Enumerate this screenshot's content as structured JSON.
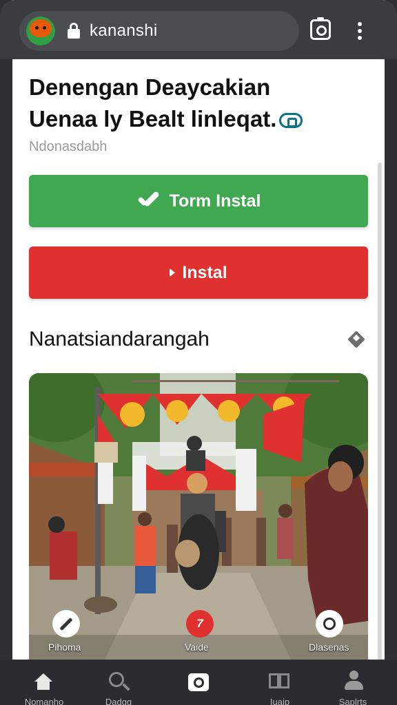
{
  "browser": {
    "url": "kananshi",
    "site_icon": "fox-face-icon",
    "secure_icon": "lock-icon",
    "actions": [
      "camera-icon",
      "more-vert-icon"
    ]
  },
  "article": {
    "headline_line1": "Denengan Deaycakian",
    "headline_line2": "Uenaa ly Bealt linleqat.",
    "subtext": "Ndonasdabh"
  },
  "buttons": {
    "primary_label": "Torm Instal",
    "secondary_label": "Instal"
  },
  "section": {
    "title": "Nanatsiandarangah"
  },
  "photo": {
    "actions": [
      {
        "label": "Pihoma",
        "icon": "pencil-icon"
      },
      {
        "label": "Vaide",
        "icon": "video-icon",
        "badge": "7"
      },
      {
        "label": "Dlasenas",
        "icon": "share-icon"
      }
    ]
  },
  "nav": {
    "items": [
      {
        "label": "Nomanho",
        "icon": "home-icon"
      },
      {
        "label": "Dadgg",
        "icon": "search-icon"
      },
      {
        "label": "",
        "icon": "camera-icon"
      },
      {
        "label": "Iuaip",
        "icon": "book-icon"
      },
      {
        "label": "Saplrts",
        "icon": "profile-icon"
      }
    ]
  },
  "colors": {
    "primary_button": "#40a850",
    "secondary_button": "#e03131",
    "toolbar": "#3a3c3f",
    "nav_bar": "#2a2c2f"
  }
}
